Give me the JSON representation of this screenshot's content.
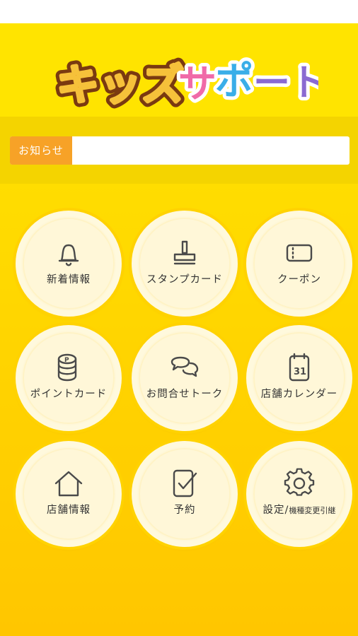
{
  "app": {
    "logo": {
      "part1": "キッズ",
      "part2": "サ",
      "part3": "ポ",
      "part4": "ート"
    }
  },
  "notice": {
    "label": "お知らせ",
    "text": ""
  },
  "menu": [
    {
      "id": "news",
      "label": "新着情報",
      "icon": "bell-icon"
    },
    {
      "id": "stamp",
      "label": "スタンプカード",
      "icon": "stamp-icon"
    },
    {
      "id": "coupon",
      "label": "クーポン",
      "icon": "ticket-icon"
    },
    {
      "id": "point",
      "label": "ポイントカード",
      "icon": "coins-icon"
    },
    {
      "id": "talk",
      "label": "お問合せトーク",
      "icon": "chat-icon"
    },
    {
      "id": "calendar",
      "label": "店舗カレンダー",
      "icon": "calendar-icon",
      "icon_text": "31"
    },
    {
      "id": "store",
      "label": "店舗情報",
      "icon": "house-icon"
    },
    {
      "id": "reserve",
      "label": "予約",
      "icon": "checklist-icon"
    },
    {
      "id": "settings",
      "label": "設定/",
      "label_small": "機種変更引継",
      "icon": "gear-icon"
    }
  ],
  "colors": {
    "primary": "#ffe400",
    "accent": "#f7a227",
    "circle": "#fff7d8"
  }
}
